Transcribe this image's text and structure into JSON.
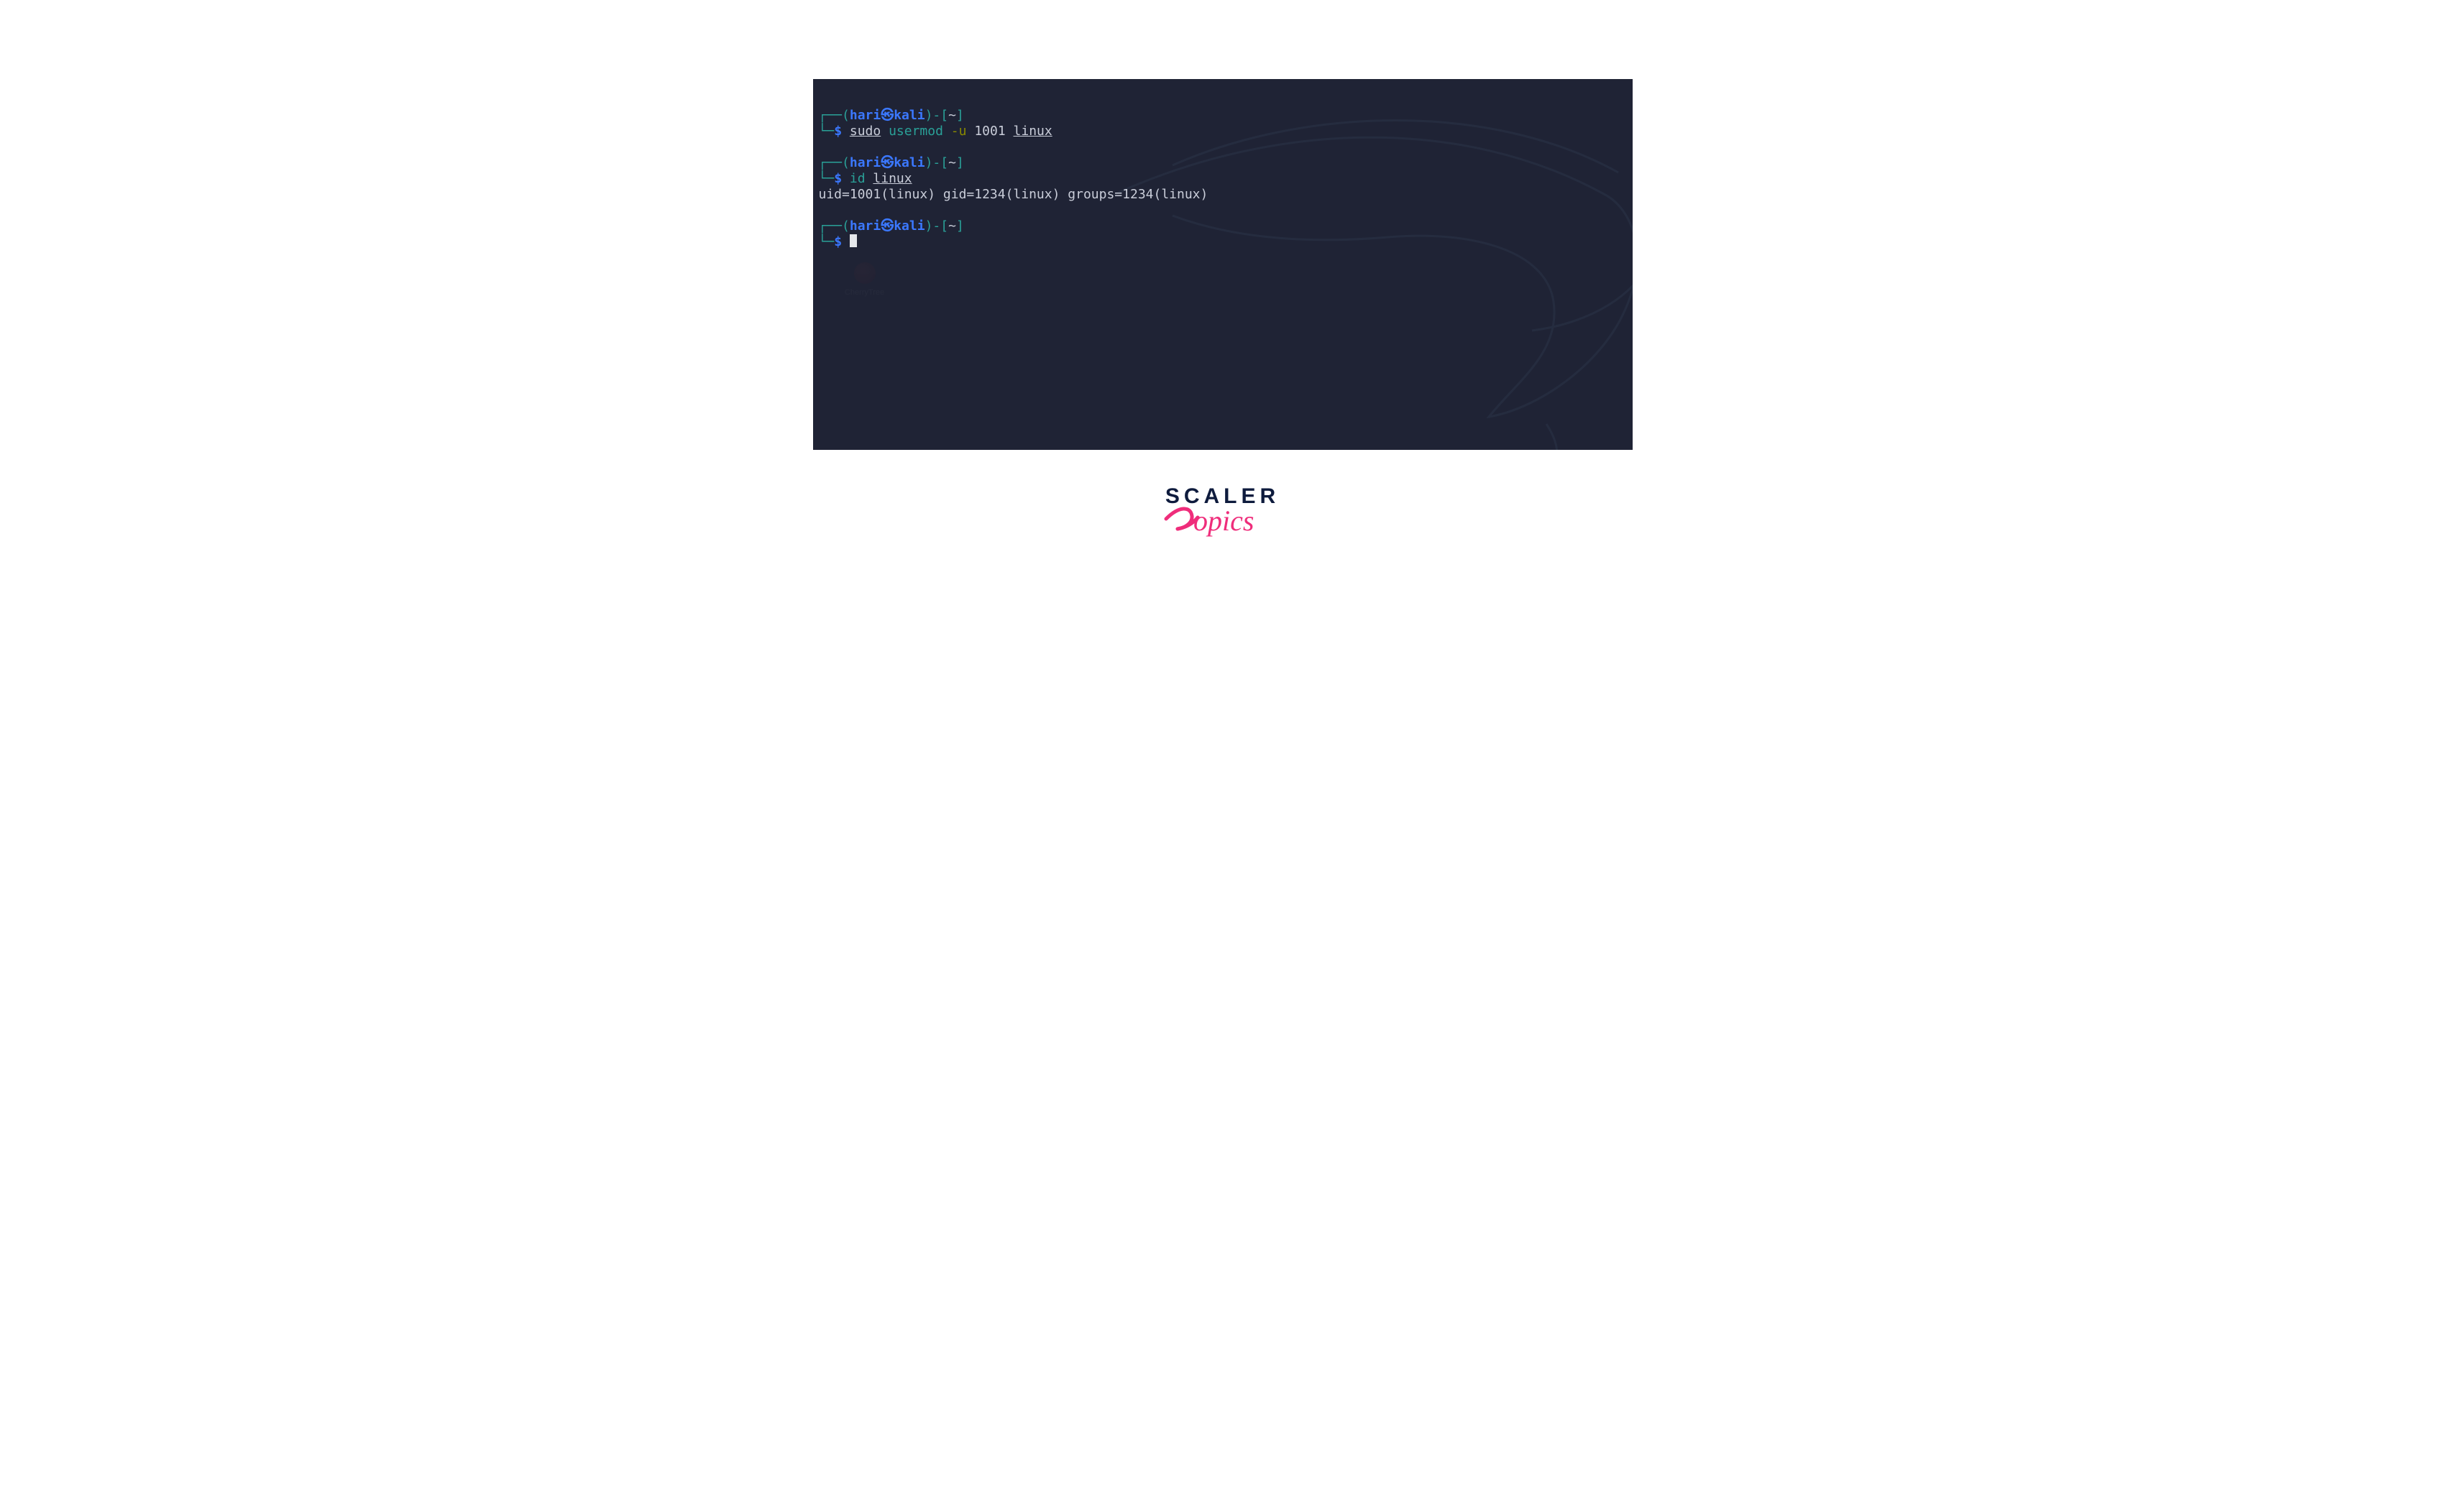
{
  "colors": {
    "terminal_bg": "#1f2335",
    "prompt_blue": "#3b78ff",
    "prompt_teal": "#2aa198",
    "text_default": "#c9cdd9",
    "brand_dark": "#0e1b3d",
    "brand_pink": "#ef2d7b"
  },
  "prompt": {
    "user": "hari",
    "host": "kali",
    "path": "~",
    "symbol": "$",
    "lparen": "(",
    "rparen": ")",
    "lbrack": "[",
    "rbrack": "]",
    "dash": "-",
    "box_top": "┌──",
    "box_bottom": "└─",
    "skull_icon": "㉿"
  },
  "blocks": [
    {
      "command_parts": {
        "sudo": "sudo",
        "cmd": "usermod",
        "flag": "-u",
        "uid": "1001",
        "target": "linux"
      },
      "output": ""
    },
    {
      "command_parts": {
        "cmd": "id",
        "target": "linux"
      },
      "output": "uid=1001(linux) gid=1234(linux) groups=1234(linux)"
    },
    {
      "command_parts": {},
      "output": ""
    }
  ],
  "bg_app_label": "CherryTree",
  "watermark": {
    "line1": "SCALER",
    "line2": "Topics"
  }
}
